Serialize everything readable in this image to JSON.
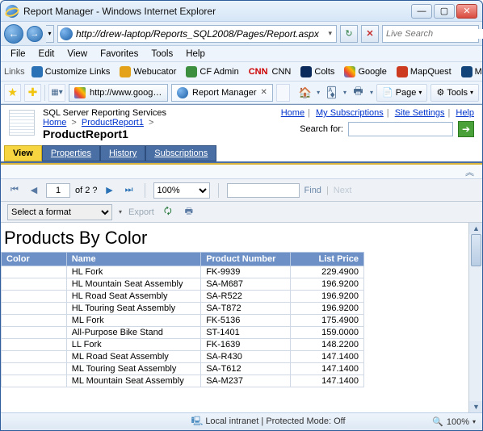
{
  "window": {
    "title": "Report Manager - Windows Internet Explorer"
  },
  "nav": {
    "url": "http://drew-laptop/Reports_SQL2008/Pages/Report.aspx",
    "search_placeholder": "Live Search"
  },
  "menu": [
    "File",
    "Edit",
    "View",
    "Favorites",
    "Tools",
    "Help"
  ],
  "links_label": "Links",
  "links": [
    {
      "label": "Customize Links",
      "color": "#2a72b5"
    },
    {
      "label": "Webucator",
      "color": "#e3a21a"
    },
    {
      "label": "CF Admin",
      "color": "#3c8f3f"
    },
    {
      "label": "CNN",
      "color": "#cc0000",
      "prefix": "CNN",
      "prefix_color": "#cc0000"
    },
    {
      "label": "Colts",
      "color": "#0a2a5c"
    },
    {
      "label": "Google",
      "color": "#2a72b5"
    },
    {
      "label": "MapQuest",
      "color": "#cc3a1f"
    },
    {
      "label": "MSNBC",
      "color": "#13447a"
    }
  ],
  "tabs": [
    {
      "label": "http://www.google...",
      "active": false,
      "icon": "google"
    },
    {
      "label": "Report Manager",
      "active": true,
      "icon": "ie"
    }
  ],
  "toolbar": {
    "page": "Page",
    "tools": "Tools"
  },
  "rm": {
    "service": "SQL Server Reporting Services",
    "breadcrumb": [
      "Home",
      "ProductReport1"
    ],
    "title": "ProductReport1",
    "toplinks": [
      "Home",
      "My Subscriptions",
      "Site Settings",
      "Help"
    ],
    "search_label": "Search for:",
    "tabs": [
      "View",
      "Properties",
      "History",
      "Subscriptions"
    ]
  },
  "viewer": {
    "page_current": "1",
    "page_of": "of 2 ?",
    "zoom": "100%",
    "find": "Find",
    "next": "Next",
    "format_placeholder": "Select a format",
    "export": "Export"
  },
  "report": {
    "title": "Products By Color",
    "columns": [
      "Color",
      "Name",
      "Product Number",
      "List Price"
    ],
    "rows": [
      {
        "color": "",
        "name": "HL Fork",
        "pn": "FK-9939",
        "price": "229.4900"
      },
      {
        "color": "",
        "name": "HL Mountain Seat Assembly",
        "pn": "SA-M687",
        "price": "196.9200"
      },
      {
        "color": "",
        "name": "HL Road Seat Assembly",
        "pn": "SA-R522",
        "price": "196.9200"
      },
      {
        "color": "",
        "name": "HL Touring Seat Assembly",
        "pn": "SA-T872",
        "price": "196.9200"
      },
      {
        "color": "",
        "name": "ML Fork",
        "pn": "FK-5136",
        "price": "175.4900"
      },
      {
        "color": "",
        "name": "All-Purpose Bike Stand",
        "pn": "ST-1401",
        "price": "159.0000"
      },
      {
        "color": "",
        "name": "LL Fork",
        "pn": "FK-1639",
        "price": "148.2200"
      },
      {
        "color": "",
        "name": "ML Road Seat Assembly",
        "pn": "SA-R430",
        "price": "147.1400"
      },
      {
        "color": "",
        "name": "ML Touring Seat Assembly",
        "pn": "SA-T612",
        "price": "147.1400"
      },
      {
        "color": "",
        "name": "ML Mountain Seat Assembly",
        "pn": "SA-M237",
        "price": "147.1400"
      }
    ]
  },
  "status": {
    "zone": "Local intranet | Protected Mode: Off",
    "zoom": "100%"
  }
}
